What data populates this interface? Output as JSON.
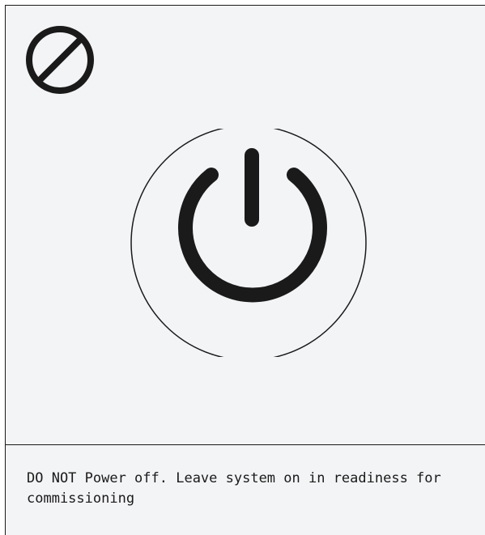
{
  "icons": {
    "prohibition": "prohibited-icon",
    "power": "power-icon"
  },
  "colors": {
    "ink": "#1a1a1a",
    "background": "#f3f4f6"
  },
  "notice": {
    "text": "DO NOT Power off. Leave system on in readiness for commissioning"
  }
}
